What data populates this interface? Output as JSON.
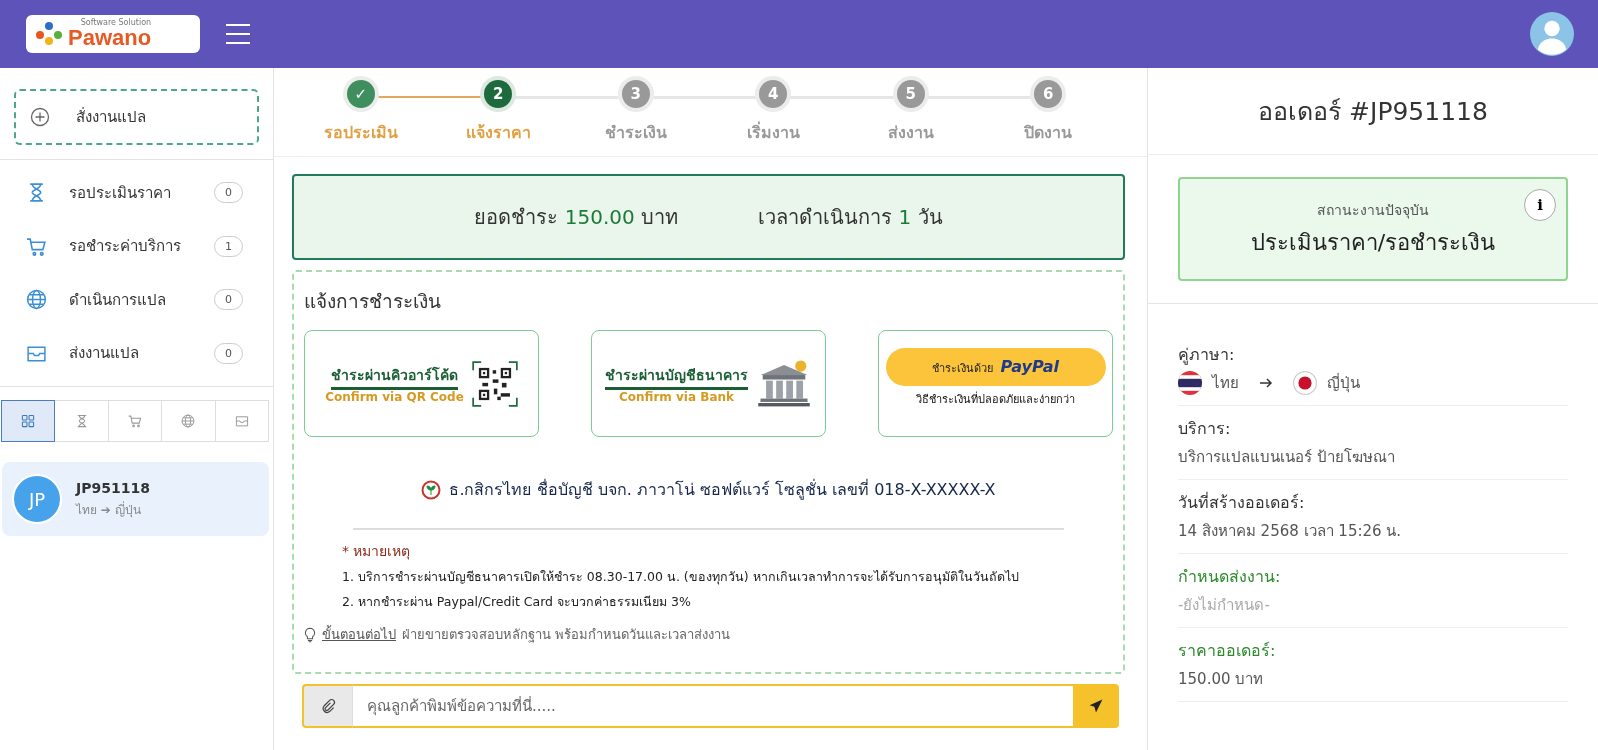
{
  "header": {
    "logo_text": "Pawano",
    "logo_tagline": "Software Solution"
  },
  "sidebar": {
    "new_order": "สั่งงานแปล",
    "menu": [
      {
        "kind": "hourglass",
        "label": "รอประเมินราคา",
        "count": "0"
      },
      {
        "kind": "cart",
        "label": "รอชำระค่าบริการ",
        "count": "1"
      },
      {
        "kind": "globe",
        "label": "ดำเนินการแปล",
        "count": "0"
      },
      {
        "kind": "inbox",
        "label": "ส่งงานแปล",
        "count": "0"
      }
    ],
    "filters": [
      {
        "kind": "grid",
        "selected": true
      },
      {
        "kind": "hourglass",
        "selected": false
      },
      {
        "kind": "cart",
        "selected": false
      },
      {
        "kind": "globe",
        "selected": false
      },
      {
        "kind": "inbox",
        "selected": false
      }
    ],
    "orders": [
      {
        "avatar": "JP",
        "id": "JP951118",
        "route": "ไทย ➔ ญี่ปุ่น",
        "selected": true
      }
    ]
  },
  "steps": [
    {
      "marker": "✓",
      "label": "รอประเมิน",
      "done": true,
      "selected": false
    },
    {
      "marker": "2",
      "label": "แจ้งราคา",
      "done": false,
      "selected": true
    },
    {
      "marker": "3",
      "label": "ชำระเงิน",
      "done": false,
      "selected": false
    },
    {
      "marker": "4",
      "label": "เริ่มงาน",
      "done": false,
      "selected": false
    },
    {
      "marker": "5",
      "label": "ส่งงาน",
      "done": false,
      "selected": false
    },
    {
      "marker": "6",
      "label": "ปิดงาน",
      "done": false,
      "selected": false
    }
  ],
  "summary": {
    "amount_label": "ยอดชำระ",
    "amount": "150.00",
    "amount_unit": "บาท",
    "time_label": "เวลาดำเนินการ",
    "time": "1",
    "time_unit": "วัน"
  },
  "payment": {
    "title": "แจ้งการชำระเงิน",
    "options": [
      {
        "kind": "qr",
        "title": "ชำระผ่านคิวอาร์โค้ด",
        "subtitle": "Confirm via QR Code"
      },
      {
        "kind": "bank",
        "title": "ชำระผ่านบัญชีธนาคาร",
        "subtitle": "Confirm via Bank"
      },
      {
        "kind": "paypal",
        "title": "ชำระเงินด้วย",
        "brand": "PayPal",
        "subtitle": "วิธีชำระเงินที่ปลอดภัยและง่ายกว่า"
      }
    ],
    "account": "ธ.กสิกรไทย ชื่อบัญชี บจก. ภาวาโน่ ซอฟต์แวร์ โซลูชั่น เลขที่ 018-X-XXXXX-X",
    "note_title": "* หมายเหตุ",
    "notes": [
      "1. บริการชำระผ่านบัญชีธนาคารเปิดให้ชำระ 08.30-17.00 น. (ของทุกวัน) หากเกินเวลาทำการจะได้รับการอนุมัติในวันถัดไป",
      "2. หากชำระผ่าน Paypal/Credit Card จะบวกค่าธรรมเนียม 3%"
    ],
    "next_link": "ขั้นตอนต่อไป",
    "next_text": "ฝ่ายขายตรวจสอบหลักฐาน พร้อมกำหนดวันและเวลาส่งงาน"
  },
  "chat": {
    "placeholder": "คุณลูกค้าพิมพ์ข้อความที่นี่....."
  },
  "order": {
    "title": "ออเดอร์ #JP951118",
    "status_label": "สถานะงานปัจจุบัน",
    "status": "ประเมินราคา/รอชำระเงิน",
    "info_button": "i",
    "fields": [
      {
        "kind": "languages",
        "label": "คู่ภาษา:",
        "from": "ไทย",
        "to": "ญี่ปุ่น",
        "emphasis": false
      },
      {
        "kind": "text",
        "label": "บริการ:",
        "value": "บริการแปลแบนเนอร์ ป้ายโฆษณา",
        "emphasis": false
      },
      {
        "kind": "text",
        "label": "วันที่สร้างออเดอร์:",
        "value": "14 สิงหาคม 2568 เวลา 15:26 น.",
        "emphasis": false
      },
      {
        "kind": "muted",
        "label": "กำหนดส่งงาน:",
        "value": "-ยังไม่กำหนด-",
        "emphasis": true
      },
      {
        "kind": "text",
        "label": "ราคาออเดอร์:",
        "value": "150.00 บาท",
        "emphasis": true
      }
    ]
  }
}
